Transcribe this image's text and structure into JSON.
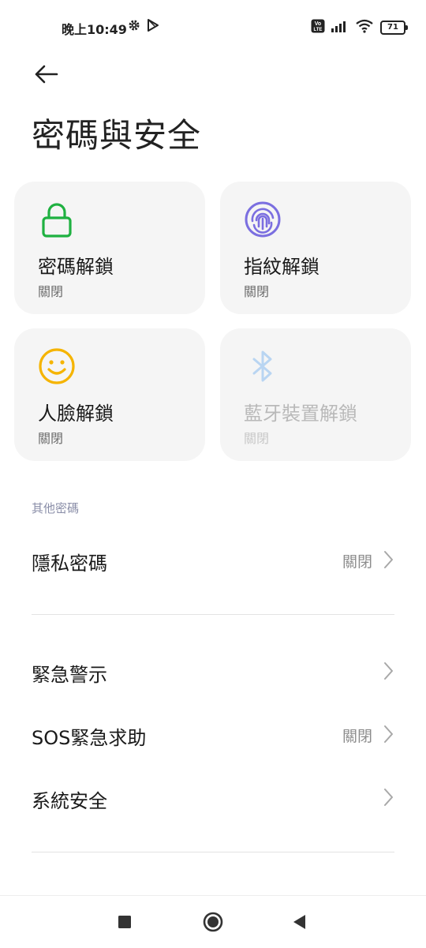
{
  "status_bar": {
    "time": "晚上10:49",
    "battery": "71",
    "icons": [
      "settings-icon",
      "play-store-icon",
      "volte-icon",
      "signal-icon",
      "wifi-icon",
      "battery-icon"
    ]
  },
  "header": {
    "back_icon": "arrow-left-icon",
    "title": "密碼與安全"
  },
  "cards": [
    {
      "title": "密碼解鎖",
      "status": "關閉",
      "icon": "lock-icon",
      "color": "#1fb141",
      "enabled": true
    },
    {
      "title": "指紋解鎖",
      "status": "關閉",
      "icon": "fingerprint-icon",
      "color": "#7b6fe0",
      "enabled": true
    },
    {
      "title": "人臉解鎖",
      "status": "關閉",
      "icon": "smiley-icon",
      "color": "#f5b400",
      "enabled": true
    },
    {
      "title": "藍牙裝置解鎖",
      "status": "關閉",
      "icon": "bluetooth-icon",
      "color": "#b9d5f2",
      "enabled": false
    }
  ],
  "other_passwords": {
    "header": "其他密碼",
    "items": [
      {
        "label": "隱私密碼",
        "value": "關閉"
      }
    ]
  },
  "settings": [
    {
      "label": "緊急警示",
      "value": ""
    },
    {
      "label": "SOS緊急求助",
      "value": "關閉"
    },
    {
      "label": "系統安全",
      "value": ""
    }
  ],
  "nav_bar": {
    "buttons": [
      "recents-square-icon",
      "home-circle-icon",
      "back-triangle-icon"
    ]
  }
}
